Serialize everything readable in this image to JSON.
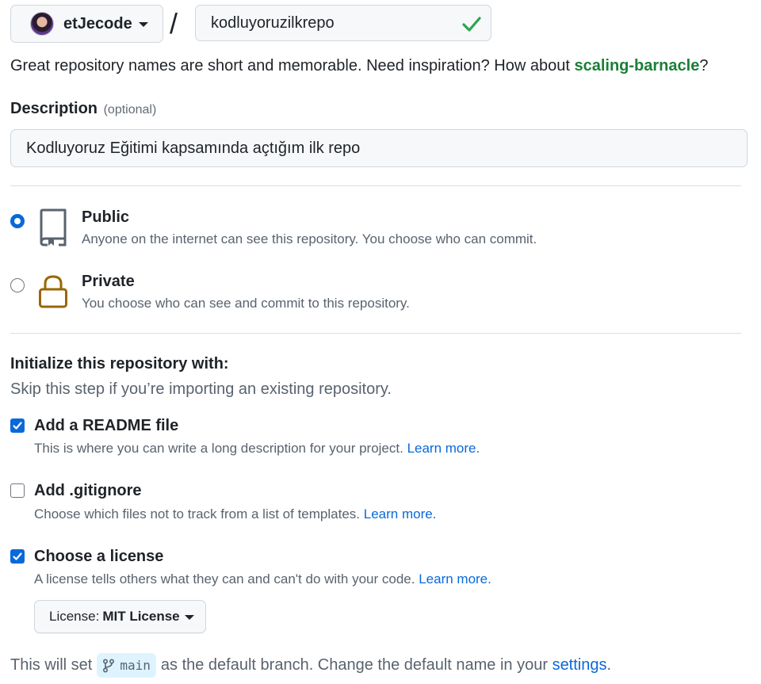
{
  "owner": {
    "name": "etJecode",
    "avatar_icon": "user-avatar"
  },
  "separator": "/",
  "repo": {
    "value": "kodluyoruzilkrepo",
    "valid_icon": "check-icon"
  },
  "hint": {
    "prefix": "Great repository names are short and memorable. Need inspiration? How about ",
    "suggestion": "scaling-barnacle",
    "suffix": "?"
  },
  "description": {
    "label": "Description",
    "optional": "(optional)",
    "value": "Kodluyoruz Eğitimi kapsamında açtığım ilk repo"
  },
  "visibility": {
    "selected": "public",
    "public": {
      "title": "Public",
      "desc": "Anyone on the internet can see this repository. You choose who can commit.",
      "icon": "repo-icon"
    },
    "private": {
      "title": "Private",
      "desc": "You choose who can see and commit to this repository.",
      "icon": "lock-icon"
    }
  },
  "init": {
    "title": "Initialize this repository with:",
    "subtitle": "Skip this step if you’re importing an existing repository.",
    "readme": {
      "checked": true,
      "title": "Add a README file",
      "desc": "This is where you can write a long description for your project.",
      "link": "Learn more."
    },
    "gitignore": {
      "checked": false,
      "title": "Add .gitignore",
      "desc": "Choose which files not to track from a list of templates.",
      "link": "Learn more."
    },
    "license": {
      "checked": true,
      "title": "Choose a license",
      "desc": "A license tells others what they can and can't do with your code.",
      "link": "Learn more."
    }
  },
  "license_select": {
    "label": "License:",
    "value": "MIT License"
  },
  "branch": {
    "prefix": "This will set",
    "name": "main",
    "middle": "as the default branch. Change the default name in your",
    "link": "settings",
    "suffix": "."
  },
  "colors": {
    "accent": "#0969da",
    "success": "#1a7f37",
    "lock": "#9a6700"
  }
}
